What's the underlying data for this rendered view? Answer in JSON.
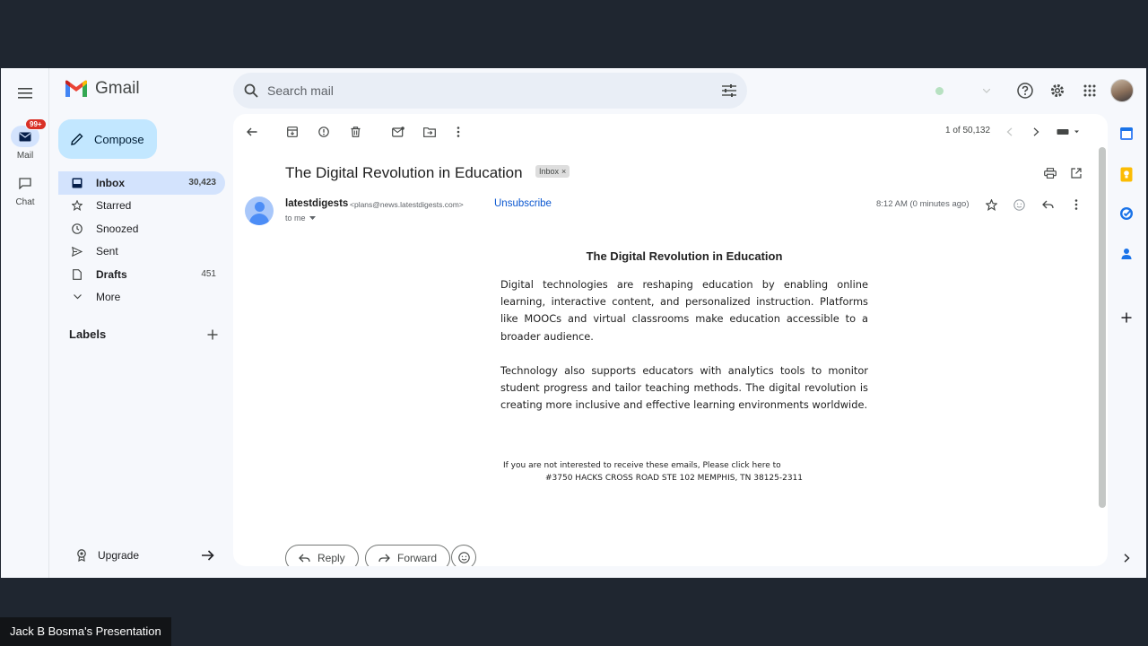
{
  "app": {
    "name": "Gmail"
  },
  "colors": {
    "accent": "#0b57d0",
    "compose_bg": "#c2e7ff",
    "active_bg": "#d3e3fd",
    "badge": "#d93025",
    "frame_bg": "#f6f8fc"
  },
  "rail": {
    "mail_label": "Mail",
    "mail_badge": "99+",
    "chat_label": "Chat"
  },
  "search": {
    "placeholder": "Search mail"
  },
  "compose": {
    "label": "Compose"
  },
  "nav": [
    {
      "label": "Inbox",
      "count": "30,423",
      "icon": "inbox-icon"
    },
    {
      "label": "Starred",
      "count": "",
      "icon": "star-icon"
    },
    {
      "label": "Snoozed",
      "count": "",
      "icon": "clock-icon"
    },
    {
      "label": "Sent",
      "count": "",
      "icon": "send-icon"
    },
    {
      "label": "Drafts",
      "count": "451",
      "icon": "draft-icon"
    },
    {
      "label": "More",
      "count": "",
      "icon": "chevron-down-icon"
    }
  ],
  "labels": {
    "title": "Labels"
  },
  "upgrade": {
    "label": "Upgrade"
  },
  "toolbar": {
    "pager": "1 of 50,132"
  },
  "email": {
    "subject": "The Digital Revolution in Education",
    "tag": "Inbox",
    "sender_name": "latestdigests",
    "sender_email": "<plans@news.latestdigests.com>",
    "unsubscribe": "Unsubscribe",
    "to": "to me",
    "time": "8:12 AM (0 minutes ago)",
    "body_title": "The Digital Revolution in Education",
    "paragraphs": [
      "Digital technologies are reshaping education by enabling online learning, interactive content, and personalized instruction. Platforms like MOOCs and virtual classrooms make education accessible to a broader audience.",
      "Technology also supports educators with analytics tools to monitor student progress and tailor teaching methods. The digital revolution is creating more inclusive and effective learning environments worldwide."
    ],
    "footer_line1": "If you are not interested to receive these emails, Please click here to",
    "footer_line2": "#3750 HACKS CROSS ROAD STE 102 MEMPHIS, TN 38125-2311"
  },
  "actions": {
    "reply": "Reply",
    "forward": "Forward"
  },
  "presenter": {
    "label": "Jack B Bosma's Presentation"
  }
}
